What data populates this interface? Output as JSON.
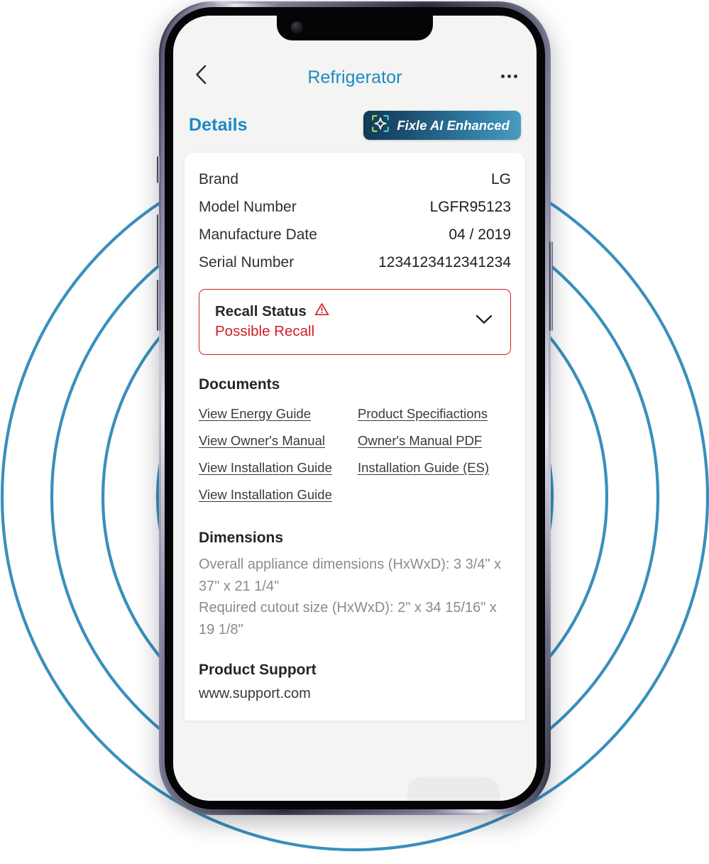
{
  "app": {
    "nav": {
      "back_icon": "chevron-left-icon",
      "title": "Refrigerator",
      "more_icon": "more-horizontal-icon"
    },
    "details_header": {
      "title": "Details",
      "badge_label": "Fixle AI Enhanced",
      "badge_icon": "ai-sparkle-scan-icon",
      "badge_gradient_from": "#123a57",
      "badge_gradient_to": "#4a9cc0"
    },
    "specs": [
      {
        "label": "Brand",
        "value": "LG"
      },
      {
        "label": "Model Number",
        "value": "LGFR95123"
      },
      {
        "label": "Manufacture Date",
        "value": "04 / 2019"
      },
      {
        "label": "Serial Number",
        "value": "1234123412341234"
      }
    ],
    "recall": {
      "title": "Recall Status",
      "status": "Possible Recall",
      "warning_icon": "warning-triangle-icon",
      "expand_icon": "chevron-down-icon",
      "accent_color": "#cf2026"
    },
    "documents": {
      "title": "Documents",
      "links": [
        "View Energy Guide",
        "Product Specifiactions",
        "View Owner's Manual",
        "Owner's Manual PDF",
        "View Installation Guide",
        "Installation Guide (ES)",
        "View Installation Guide"
      ]
    },
    "dimensions": {
      "title": "Dimensions",
      "lines": [
        "Overall appliance dimensions (HxWxD): 3 3/4\" x 37\" x 21 1/4\"",
        "Required cutout size (HxWxD): 2\" x 34 15/16\" x 19 1/8\""
      ]
    },
    "support": {
      "title": "Product Support",
      "url": "www.support.com"
    },
    "colors": {
      "accent_blue": "#1a8ac4",
      "ring_blue": "#3a8fbd",
      "screen_bg": "#f4f4f2",
      "card_bg": "#ffffff"
    }
  },
  "device": {
    "side_buttons": [
      "silent-switch",
      "volume-up",
      "volume-down",
      "power"
    ]
  }
}
